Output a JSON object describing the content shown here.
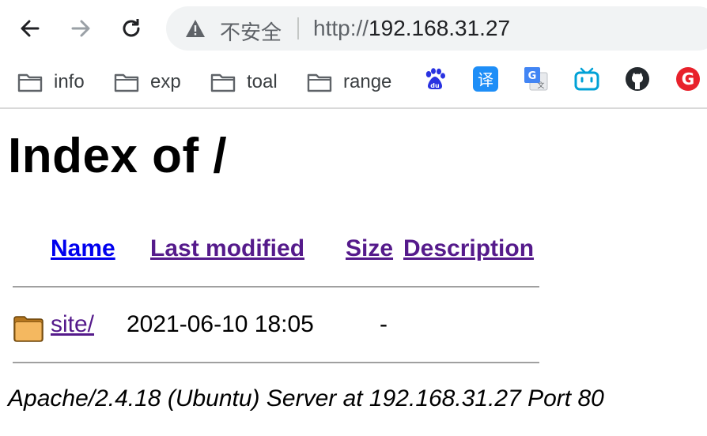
{
  "browser": {
    "security_label": "不安全",
    "url_scheme": "http://",
    "url_host": "192.168.31.27",
    "bookmarks": [
      {
        "label": "info",
        "icon": "folder-icon"
      },
      {
        "label": "exp",
        "icon": "folder-icon"
      },
      {
        "label": "toal",
        "icon": "folder-icon"
      },
      {
        "label": "range",
        "icon": "folder-icon"
      }
    ],
    "bookmark_icons": [
      "baidu-icon",
      "translate-icon",
      "google-translate-icon",
      "bilibili-icon",
      "github-icon",
      "g-icon"
    ]
  },
  "page": {
    "title": "Index of /",
    "columns": {
      "name": "Name",
      "last_modified": "Last modified",
      "size": "Size",
      "description": "Description"
    },
    "rows": [
      {
        "name": "site/",
        "last_modified": "2021-06-10 18:05",
        "size": "-",
        "icon": "folder-icon"
      }
    ],
    "address": "Apache/2.4.18 (Ubuntu) Server at 192.168.31.27 Port 80"
  }
}
